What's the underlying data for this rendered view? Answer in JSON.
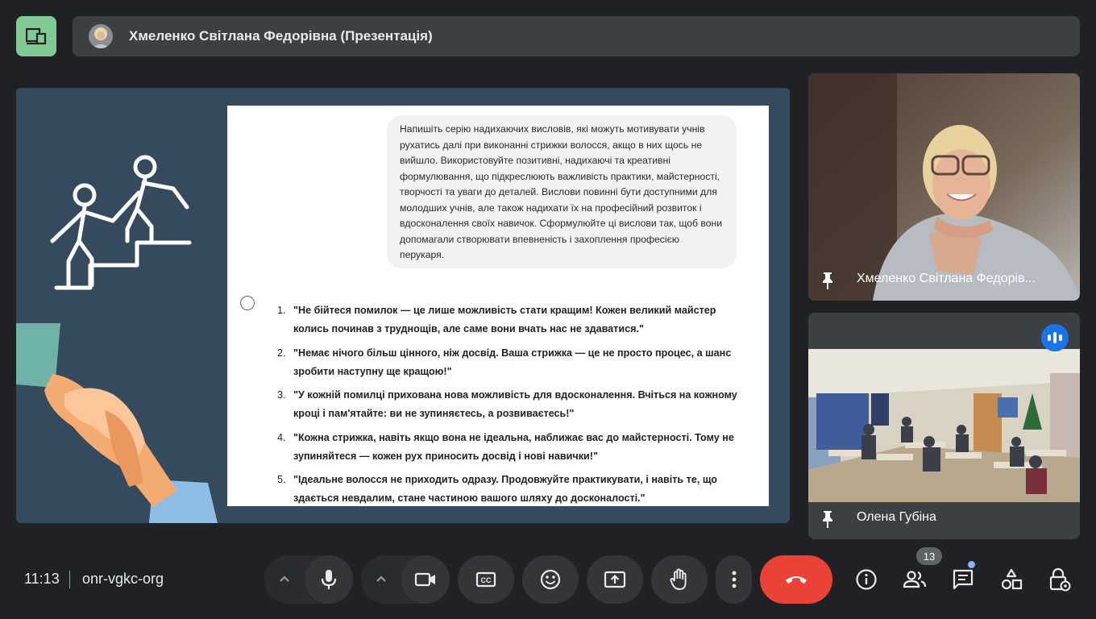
{
  "header": {
    "presenter_title": "Хмеленко Світлана Федорівна (Презентація)"
  },
  "slide": {
    "prompt": "Напишіть серію надихаючих висловів, які можуть мотивувати учнів рухатись далі при виконанні стрижки волосся, акщо в них щось не вийшло. Використовуйте позитивні, надихаючі та креативні формулювання, що підкреслюють важливість практики, майстерності, творчості та уваги до деталей. Вислови повинні бути доступними для молодших учнів, але також надихати їх на професійний розвиток і вдосконалення своїх навичок. Сформулюйте ці вислови так, щоб вони допомагали створювати впевненість і захоплення професією перукаря.",
    "answers": [
      {
        "num": "1.",
        "text": "\"Не бійтеся помилок — це лише можливість стати кращим! Кожен великий майстер колись починав з труднощів, але саме вони вчать нас не здаватися.\""
      },
      {
        "num": "2.",
        "text": "\"Немає нічого більш цінного, ніж досвід. Ваша стрижка — це не просто процес, а шанс зробити наступну ще кращою!\""
      },
      {
        "num": "3.",
        "text": "\"У кожній помилці прихована нова можливість для вдосконалення. Вчіться на кожному кроці і пам'ятайте: ви не зупиняєтесь, а розвиваєтесь!\""
      },
      {
        "num": "4.",
        "text": "\"Кожна стрижка, навіть якщо вона не ідеальна, наближає вас до майстерності. Тому не зупиняйтеся — кожен рух приносить досвід і нові навички!\""
      },
      {
        "num": "5.",
        "text": "\"Ідеальне волосся не приходить одразу. Продовжуйте практикувати, і навіть те, що здається невдалим, стане частиною вашого шляху до досконалості.\""
      }
    ]
  },
  "participants": [
    {
      "name": "Хмеленко Світлана Федорів..."
    },
    {
      "name": "Олена Губіна"
    }
  ],
  "footer": {
    "time": "11:13",
    "meeting_code": "onr-vgkc-org",
    "people_count": "13"
  },
  "icons": {
    "layout": "layout-icon",
    "mic": "mic-icon",
    "camera": "camera-icon",
    "captions": "captions-icon",
    "emoji": "emoji-icon",
    "present": "present-screen-icon",
    "raise_hand": "raise-hand-icon",
    "more": "more-options-icon",
    "leave": "leave-call-icon",
    "info": "info-icon",
    "people": "people-icon",
    "chat": "chat-icon",
    "activities": "activities-icon",
    "host_controls": "host-controls-icon"
  },
  "colors": {
    "background": "#202124",
    "layout_button": "#81c995",
    "leave_button": "#ea4335",
    "slide_background": "#364a5d",
    "speaking_indicator": "#1a73e8"
  }
}
